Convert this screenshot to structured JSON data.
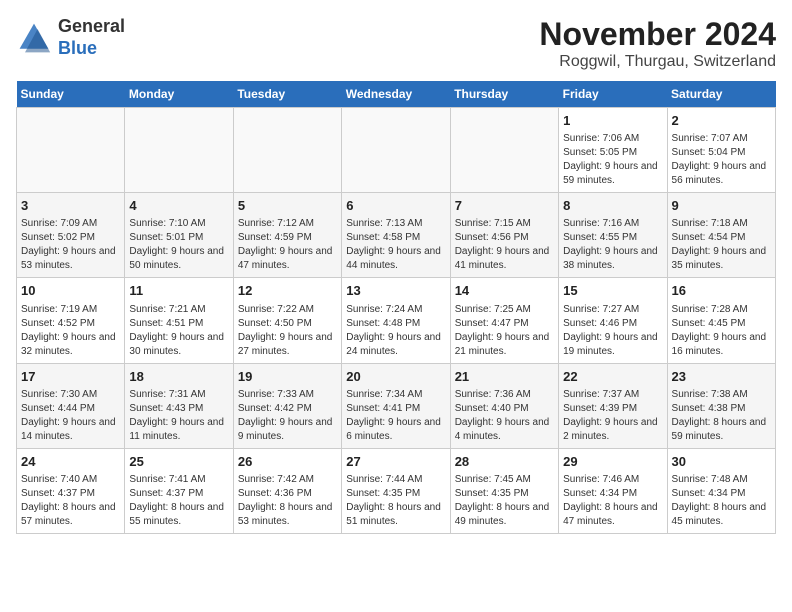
{
  "logo": {
    "line1": "General",
    "line2": "Blue"
  },
  "header": {
    "month": "November 2024",
    "location": "Roggwil, Thurgau, Switzerland"
  },
  "weekdays": [
    "Sunday",
    "Monday",
    "Tuesday",
    "Wednesday",
    "Thursday",
    "Friday",
    "Saturday"
  ],
  "weeks": [
    [
      {
        "day": "",
        "info": ""
      },
      {
        "day": "",
        "info": ""
      },
      {
        "day": "",
        "info": ""
      },
      {
        "day": "",
        "info": ""
      },
      {
        "day": "",
        "info": ""
      },
      {
        "day": "1",
        "info": "Sunrise: 7:06 AM\nSunset: 5:05 PM\nDaylight: 9 hours and 59 minutes."
      },
      {
        "day": "2",
        "info": "Sunrise: 7:07 AM\nSunset: 5:04 PM\nDaylight: 9 hours and 56 minutes."
      }
    ],
    [
      {
        "day": "3",
        "info": "Sunrise: 7:09 AM\nSunset: 5:02 PM\nDaylight: 9 hours and 53 minutes."
      },
      {
        "day": "4",
        "info": "Sunrise: 7:10 AM\nSunset: 5:01 PM\nDaylight: 9 hours and 50 minutes."
      },
      {
        "day": "5",
        "info": "Sunrise: 7:12 AM\nSunset: 4:59 PM\nDaylight: 9 hours and 47 minutes."
      },
      {
        "day": "6",
        "info": "Sunrise: 7:13 AM\nSunset: 4:58 PM\nDaylight: 9 hours and 44 minutes."
      },
      {
        "day": "7",
        "info": "Sunrise: 7:15 AM\nSunset: 4:56 PM\nDaylight: 9 hours and 41 minutes."
      },
      {
        "day": "8",
        "info": "Sunrise: 7:16 AM\nSunset: 4:55 PM\nDaylight: 9 hours and 38 minutes."
      },
      {
        "day": "9",
        "info": "Sunrise: 7:18 AM\nSunset: 4:54 PM\nDaylight: 9 hours and 35 minutes."
      }
    ],
    [
      {
        "day": "10",
        "info": "Sunrise: 7:19 AM\nSunset: 4:52 PM\nDaylight: 9 hours and 32 minutes."
      },
      {
        "day": "11",
        "info": "Sunrise: 7:21 AM\nSunset: 4:51 PM\nDaylight: 9 hours and 30 minutes."
      },
      {
        "day": "12",
        "info": "Sunrise: 7:22 AM\nSunset: 4:50 PM\nDaylight: 9 hours and 27 minutes."
      },
      {
        "day": "13",
        "info": "Sunrise: 7:24 AM\nSunset: 4:48 PM\nDaylight: 9 hours and 24 minutes."
      },
      {
        "day": "14",
        "info": "Sunrise: 7:25 AM\nSunset: 4:47 PM\nDaylight: 9 hours and 21 minutes."
      },
      {
        "day": "15",
        "info": "Sunrise: 7:27 AM\nSunset: 4:46 PM\nDaylight: 9 hours and 19 minutes."
      },
      {
        "day": "16",
        "info": "Sunrise: 7:28 AM\nSunset: 4:45 PM\nDaylight: 9 hours and 16 minutes."
      }
    ],
    [
      {
        "day": "17",
        "info": "Sunrise: 7:30 AM\nSunset: 4:44 PM\nDaylight: 9 hours and 14 minutes."
      },
      {
        "day": "18",
        "info": "Sunrise: 7:31 AM\nSunset: 4:43 PM\nDaylight: 9 hours and 11 minutes."
      },
      {
        "day": "19",
        "info": "Sunrise: 7:33 AM\nSunset: 4:42 PM\nDaylight: 9 hours and 9 minutes."
      },
      {
        "day": "20",
        "info": "Sunrise: 7:34 AM\nSunset: 4:41 PM\nDaylight: 9 hours and 6 minutes."
      },
      {
        "day": "21",
        "info": "Sunrise: 7:36 AM\nSunset: 4:40 PM\nDaylight: 9 hours and 4 minutes."
      },
      {
        "day": "22",
        "info": "Sunrise: 7:37 AM\nSunset: 4:39 PM\nDaylight: 9 hours and 2 minutes."
      },
      {
        "day": "23",
        "info": "Sunrise: 7:38 AM\nSunset: 4:38 PM\nDaylight: 8 hours and 59 minutes."
      }
    ],
    [
      {
        "day": "24",
        "info": "Sunrise: 7:40 AM\nSunset: 4:37 PM\nDaylight: 8 hours and 57 minutes."
      },
      {
        "day": "25",
        "info": "Sunrise: 7:41 AM\nSunset: 4:37 PM\nDaylight: 8 hours and 55 minutes."
      },
      {
        "day": "26",
        "info": "Sunrise: 7:42 AM\nSunset: 4:36 PM\nDaylight: 8 hours and 53 minutes."
      },
      {
        "day": "27",
        "info": "Sunrise: 7:44 AM\nSunset: 4:35 PM\nDaylight: 8 hours and 51 minutes."
      },
      {
        "day": "28",
        "info": "Sunrise: 7:45 AM\nSunset: 4:35 PM\nDaylight: 8 hours and 49 minutes."
      },
      {
        "day": "29",
        "info": "Sunrise: 7:46 AM\nSunset: 4:34 PM\nDaylight: 8 hours and 47 minutes."
      },
      {
        "day": "30",
        "info": "Sunrise: 7:48 AM\nSunset: 4:34 PM\nDaylight: 8 hours and 45 minutes."
      }
    ]
  ]
}
